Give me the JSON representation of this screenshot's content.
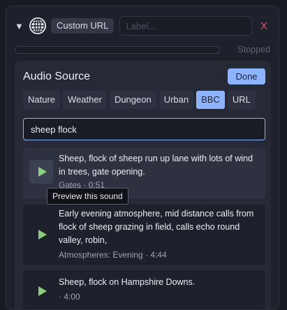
{
  "header": {
    "collapse_icon": "triangle-down-icon",
    "source_icon": "globe-icon",
    "type_badge": "Custom URL",
    "label_placeholder": "Label...",
    "label_value": "",
    "close_label": "X"
  },
  "status": {
    "progress": 0,
    "text": "Stopped"
  },
  "audio_source": {
    "title": "Audio Source",
    "done_label": "Done",
    "tabs": [
      {
        "label": "Nature",
        "active": false
      },
      {
        "label": "Weather",
        "active": false
      },
      {
        "label": "Dungeon",
        "active": false
      },
      {
        "label": "Urban",
        "active": false
      },
      {
        "label": "BBC",
        "active": true
      },
      {
        "label": "URL",
        "active": false
      }
    ],
    "search_value": "sheep flock",
    "results": [
      {
        "title": "Sheep, flock of sheep run up lane with lots of wind in trees, gate opening.",
        "meta": "Gates · 0:51"
      },
      {
        "title": "Early evening atmosphere, mid distance calls from flock of sheep grazing in field, calls echo round valley, robin,",
        "meta": "Atmospheres: Evening · 4:44"
      },
      {
        "title": "Sheep, flock on Hampshire Downs.",
        "meta": "· 4:00"
      }
    ],
    "tooltip": "Preview this sound"
  },
  "colors": {
    "accent": "#8fb4ff",
    "close": "#e0566b",
    "play": "#8bd17c"
  }
}
